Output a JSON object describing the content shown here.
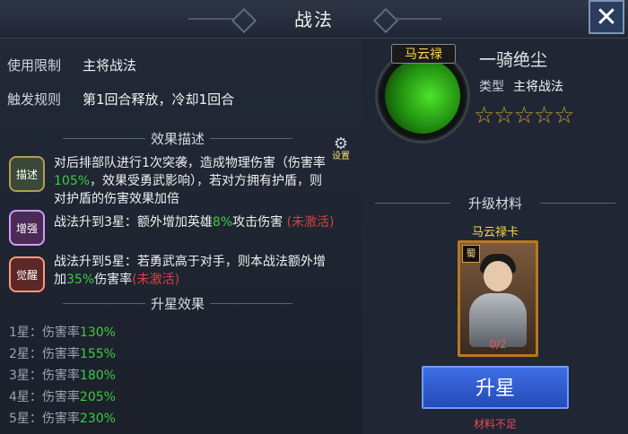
{
  "title": "战法",
  "close_glyph": "✕",
  "left": {
    "usage_label": "使用限制",
    "usage_value": "主将战法",
    "trigger_label": "触发规则",
    "trigger_value": "第1回合释放，冷却1回合",
    "settings_label": "设置",
    "effect_section": "效果描述",
    "effect_badges": [
      "描述",
      "增强",
      "觉醒"
    ],
    "effect_desc_1": "对后排部队进行1次突袭，造成物理伤害（伤害率",
    "effect_desc_2_pct": "105%",
    "effect_desc_2_rest": "，效果受勇武影响），若对方拥有护盾，则",
    "effect_desc_3": "对护盾的伤害效果加倍",
    "enh_1": "战法升到3星：额外增加英雄",
    "enh_pct": "8%",
    "enh_2": "攻击伤害",
    "enh_tag": "(未激活)",
    "awk_1": "战法升到5星：若勇武高于对手，则本战法额外增",
    "awk_2a": "加",
    "awk_pct": "35%",
    "awk_2b": "伤害率",
    "awk_tag": "(未激活)",
    "star_section": "升星效果",
    "star_rows": [
      {
        "label": "1星：伤害率",
        "pct": "130%"
      },
      {
        "label": "2星：伤害率",
        "pct": "155%"
      },
      {
        "label": "3星：伤害率",
        "pct": "180%"
      },
      {
        "label": "4星：伤害率",
        "pct": "205%"
      },
      {
        "label": "5星：伤害率",
        "pct": "230%"
      }
    ]
  },
  "right": {
    "hero_name": "马云禄",
    "skill_name": "一骑绝尘",
    "type_label": "类型",
    "type_value": "主将战法",
    "stars": "☆☆☆☆☆",
    "material_section": "升级材料",
    "card_title": "马云禄卡",
    "card_faction": "蜀",
    "card_count": "0/2",
    "upgrade_button": "升星",
    "warning": "材料不足"
  },
  "colors": {
    "accent_green": "#3fcc3f",
    "warning_red": "#d94040",
    "button_blue": "#3f6ee6",
    "gold": "#ffd64a"
  }
}
